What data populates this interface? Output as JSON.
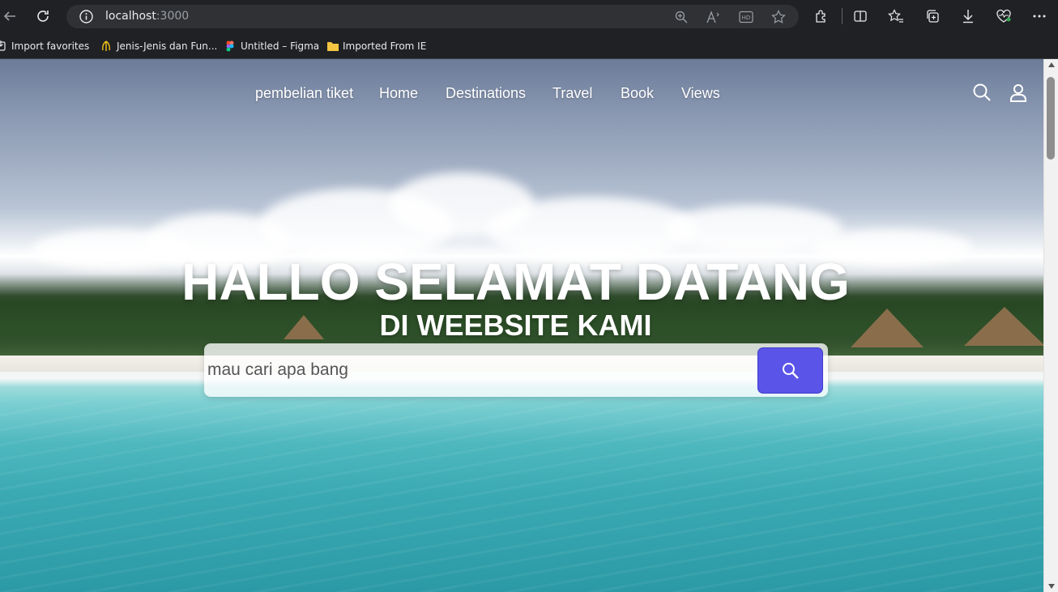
{
  "browser": {
    "url_host": "localhost",
    "url_port": ":3000",
    "icons": [
      "back-icon",
      "refresh-icon",
      "info-icon",
      "zoom-icon",
      "read-aloud-icon",
      "hd-icon",
      "favorite-star-icon",
      "extensions-icon",
      "split-screen-icon",
      "favorites-icon",
      "collections-icon",
      "download-icon",
      "health-icon",
      "more-icon"
    ]
  },
  "bookmarks": [
    {
      "label": "Import favorites"
    },
    {
      "label": "Jenis-Jenis dan Fun..."
    },
    {
      "label": "Untitled – Figma"
    },
    {
      "label": "Imported From IE"
    }
  ],
  "nav": {
    "items": [
      "pembelian tiket",
      "Home",
      "Destinations",
      "Travel",
      "Book",
      "Views"
    ]
  },
  "hero": {
    "title": "HALLO SELAMAT DATANG",
    "subtitle": "DI WEEBSITE KAMI"
  },
  "search": {
    "placeholder": "mau cari apa bang",
    "button_color": "#5a55e8"
  }
}
